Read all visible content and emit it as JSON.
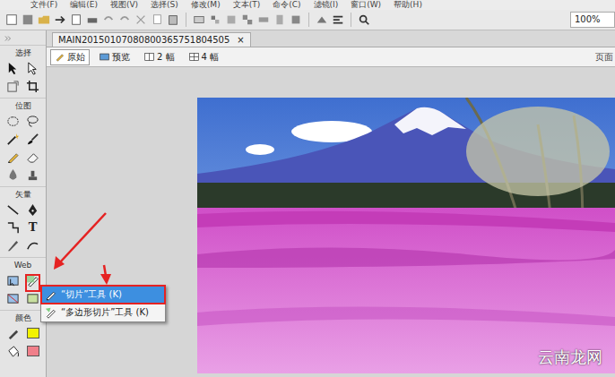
{
  "menu": [
    "文件(F)",
    "编辑(E)",
    "视图(V)",
    "选择(S)",
    "修改(M)",
    "文本(T)",
    "命令(C)",
    "滤镜(I)",
    "窗口(W)",
    "帮助(H)"
  ],
  "zoom": "100%",
  "document_tab": {
    "title": "MAIN20150107080800365751804505",
    "close": "×"
  },
  "view_tabs": [
    {
      "label": "原始",
      "selected": true
    },
    {
      "label": "预览",
      "selected": false
    },
    {
      "label": "2 幅",
      "selected": false
    },
    {
      "label": "4 幅",
      "selected": false
    }
  ],
  "page_label": "页面",
  "tool_sections": [
    {
      "title": "选择"
    },
    {
      "title": "位图"
    },
    {
      "title": "矢量"
    },
    {
      "title": "Web"
    },
    {
      "title": "颜色"
    }
  ],
  "text_tool": "T",
  "colors": {
    "stroke": "#f2f200",
    "fill": "#f07f8a"
  },
  "flyout": [
    {
      "label": "“切片”工具 (K)",
      "selected": true
    },
    {
      "label": "“多边形切片”工具 (K)",
      "selected": false
    }
  ],
  "watermark": "云南龙网"
}
